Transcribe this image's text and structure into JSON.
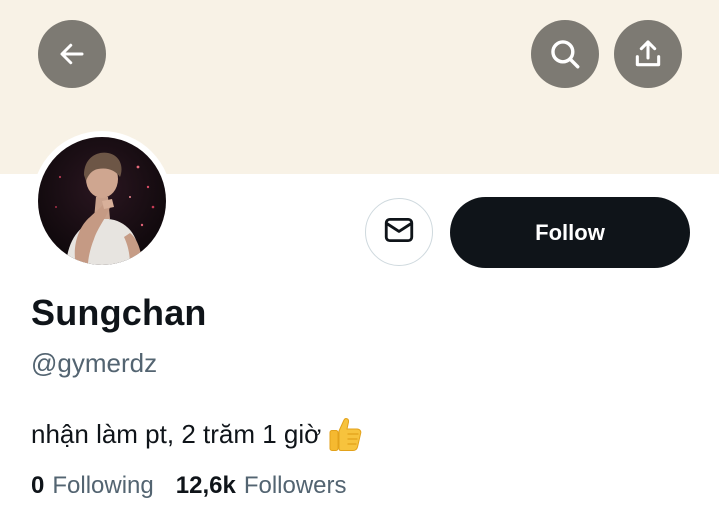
{
  "header": {
    "back_icon": "arrow-left-icon",
    "search_icon": "search-icon",
    "share_icon": "share-upload-icon",
    "banner_color": "#f8f2e6",
    "icon_button_color": "#7d7a73"
  },
  "profile": {
    "avatar_icon": "profile-photo",
    "display_name": "Sungchan",
    "handle": "@gymerdz",
    "bio": "nhận làm pt, 2 trăm 1 giờ",
    "bio_emoji": "thumbs-up-emoji"
  },
  "actions": {
    "message_icon": "envelope-icon",
    "follow_label": "Follow",
    "follow_color": "#0f1419"
  },
  "stats": {
    "following_count": "0",
    "following_label": "Following",
    "followers_count": "12,6k",
    "followers_label": "Followers"
  }
}
